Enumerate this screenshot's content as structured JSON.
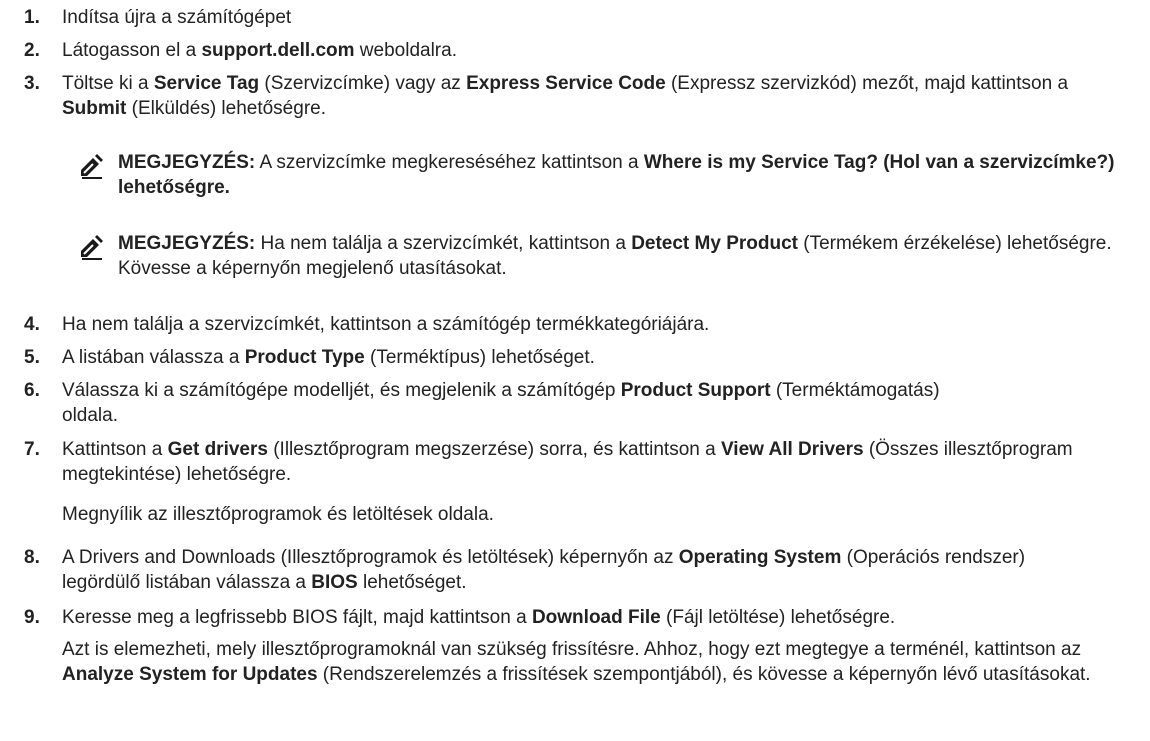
{
  "steps": [
    {
      "num": "1.",
      "parts": [
        {
          "t": "Indítsa újra a számítógépet",
          "b": false
        }
      ]
    },
    {
      "num": "2.",
      "parts": [
        {
          "t": "Látogasson el a ",
          "b": false
        },
        {
          "t": "support.dell.com",
          "b": true
        },
        {
          "t": " weboldalra.",
          "b": false
        }
      ]
    },
    {
      "num": "3.",
      "parts": [
        {
          "t": "Töltse ki a ",
          "b": false
        },
        {
          "t": "Service Tag",
          "b": true
        },
        {
          "t": " (Szervizcímke) vagy az ",
          "b": false
        },
        {
          "t": "Express Service Code",
          "b": true
        },
        {
          "t": " (Expressz szervizkód) mezőt, majd kattintson a ",
          "b": false
        },
        {
          "t": "Submit",
          "b": true
        },
        {
          "t": " (Elküldés) lehetőségre.",
          "b": false
        }
      ]
    },
    {
      "num": "4.",
      "parts": [
        {
          "t": "Ha nem találja a szervizcímkét, kattintson a számítógép termékkategóriájára.",
          "b": false
        }
      ]
    },
    {
      "num": "5.",
      "parts": [
        {
          "t": "A listában válassza a ",
          "b": false
        },
        {
          "t": "Product Type",
          "b": true
        },
        {
          "t": " (Terméktípus) lehetőséget.",
          "b": false
        }
      ]
    },
    {
      "num": "6.",
      "parts": [
        {
          "t": "Válassza ki a számítógépe modelljét, és megjelenik a számítógép ",
          "b": false
        },
        {
          "t": "Product Support",
          "b": true
        },
        {
          "t": " (Terméktámogatás) oldala.",
          "b": false
        }
      ]
    },
    {
      "num": "7.",
      "parts": [
        {
          "t": "Kattintson a ",
          "b": false
        },
        {
          "t": "Get drivers",
          "b": true
        },
        {
          "t": " (Illesztőprogram megszerzése) sorra, és kattintson a ",
          "b": false
        },
        {
          "t": "View All Drivers",
          "b": true
        },
        {
          "t": " (Összes illesztőprogram megtekintése) lehetőségre.",
          "b": false
        }
      ]
    },
    {
      "num": "8.",
      "parts": [
        {
          "t": "A Drivers and Downloads (Illesztőprogramok és letöltések) képernyőn az ",
          "b": false
        },
        {
          "t": "Operating System",
          "b": true
        },
        {
          "t": " (Operációs rendszer) legördülő listában válassza a ",
          "b": false
        },
        {
          "t": "BIOS",
          "b": true
        },
        {
          "t": " lehetőséget.",
          "b": false
        }
      ]
    },
    {
      "num": "9.",
      "parts": [
        {
          "t": "Keresse meg a legfrissebb BIOS fájlt, majd kattintson a ",
          "b": false
        },
        {
          "t": "Download File",
          "b": true
        },
        {
          "t": " (Fájl letöltése) lehetőségre.",
          "b": false
        }
      ]
    }
  ],
  "notes": [
    {
      "parts": [
        {
          "t": "MEGJEGYZÉS:",
          "b": true
        },
        {
          "t": " A szervizcímke megkereséséhez kattintson a ",
          "b": false
        },
        {
          "t": "Where is my Service Tag? (Hol van a szervizcímke?) lehetőségre.",
          "b": true
        }
      ]
    },
    {
      "parts": [
        {
          "t": "MEGJEGYZÉS:",
          "b": true
        },
        {
          "t": " Ha nem találja a szervizcímkét, kattintson a ",
          "b": false
        },
        {
          "t": "Detect My Product",
          "b": true
        },
        {
          "t": " (Termékem érzékelése) lehetőségre. Kövesse a képernyőn megjelenő utasításokat.",
          "b": false
        }
      ]
    }
  ],
  "step7_followup": "Megnyílik az illesztőprogramok és letöltések oldala.",
  "step9_followup": [
    {
      "t": "Azt is elemezheti, mely illesztőprogramoknál van szükség frissítésre. Ahhoz, hogy ezt megtegye a terménél, kattintson az ",
      "b": false
    },
    {
      "t": "Analyze System for Updates",
      "b": true
    },
    {
      "t": " (Rendszerelemzés a frissítések szempontjából), és kövesse a képernyőn lévő utasításokat.",
      "b": false
    }
  ],
  "icons": {
    "note": "pencil-note-icon"
  }
}
